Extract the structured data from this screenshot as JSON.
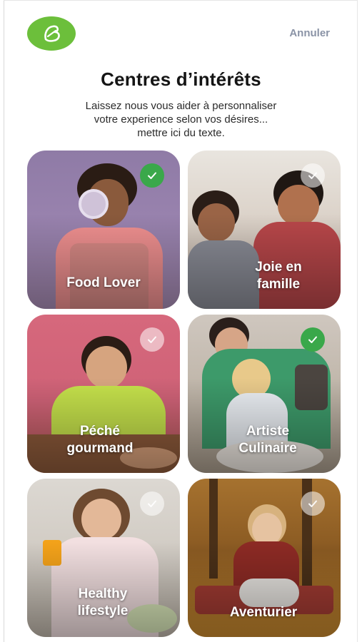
{
  "header": {
    "logo_letter": "B",
    "cancel_label": "Annuler"
  },
  "page": {
    "title": "Centres d’intérêts",
    "subtitle_line1": "Laissez nous vous aider à personnaliser",
    "subtitle_line2": "votre experience selon vos désires...",
    "subtitle_line3": "mettre ici du texte."
  },
  "cards": [
    {
      "line1": "Food Lover",
      "line2": "",
      "selected": true
    },
    {
      "line1": "Joie en",
      "line2": "famille",
      "selected": false
    },
    {
      "line1": "Péché",
      "line2": "gourmand",
      "selected": false
    },
    {
      "line1": "Artiste",
      "line2": "Culinaire",
      "selected": true
    },
    {
      "line1": "Healthy",
      "line2": "lifestyle",
      "selected": false
    },
    {
      "line1": "Aventurier",
      "line2": "",
      "selected": false
    }
  ],
  "colors": {
    "brand_green": "#6cbf3b",
    "check_green": "#3aa84a",
    "cancel_gray": "#8a93a6"
  },
  "icons": [
    "brand-logo-icon",
    "checkmark-icon"
  ]
}
